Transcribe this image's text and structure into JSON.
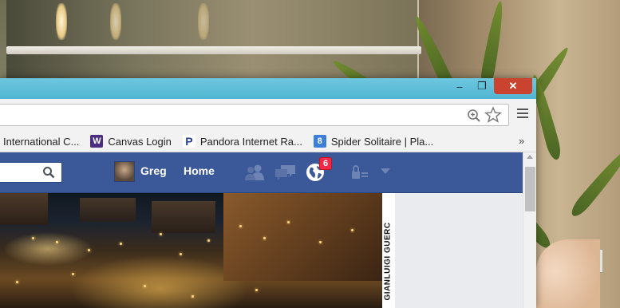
{
  "window": {
    "controls": {
      "minimize": "–",
      "maximize": "❐",
      "close": "✕"
    }
  },
  "bookmarks": {
    "items": [
      {
        "label": "International C...",
        "icon": "none"
      },
      {
        "label": "Canvas Login",
        "icon": "W"
      },
      {
        "label": "Pandora Internet Ra...",
        "icon": "P"
      },
      {
        "label": "Spider Solitaire | Pla...",
        "icon": "8"
      }
    ],
    "more": "»"
  },
  "facebook": {
    "user_name": "Greg",
    "home_label": "Home",
    "notification_count": "6"
  },
  "photo": {
    "credit": "GIANLUIGI GUERC"
  },
  "colors": {
    "titlebar": "#5bbdd8",
    "close_button": "#c9432f",
    "fb_blue": "#3b5998",
    "badge_red": "#f02849"
  }
}
